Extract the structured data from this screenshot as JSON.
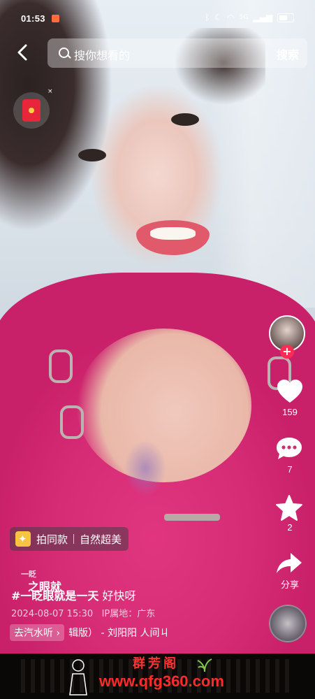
{
  "status_bar": {
    "time": "01:53",
    "network": "5G"
  },
  "search": {
    "placeholder": "搜你想看的",
    "button": "搜索"
  },
  "red_packet": {
    "close": "×"
  },
  "rail": {
    "like_count": "159",
    "comment_count": "7",
    "favorite_count": "2",
    "share_label": "分享"
  },
  "post": {
    "tag_label": "拍同款",
    "tag_topic": "自然超美",
    "username": "一眨\n之眼就",
    "caption_hashtag": "#一眨眼就是一天",
    "caption_rest": " 好快呀",
    "date": "2024-08-07 15:30",
    "ip_location": "IP属地：广东",
    "music_chip": "去汽水听 ›",
    "music_title": "辑版）  - 刘阳阳    人间ㄐ"
  },
  "watermark": {
    "title": "群芳阁",
    "url": "www.qfg360.com"
  },
  "colors": {
    "accent_red": "#fe2c55",
    "shirt_pink": "#d62c76",
    "watermark_red": "#ff2a2a"
  }
}
